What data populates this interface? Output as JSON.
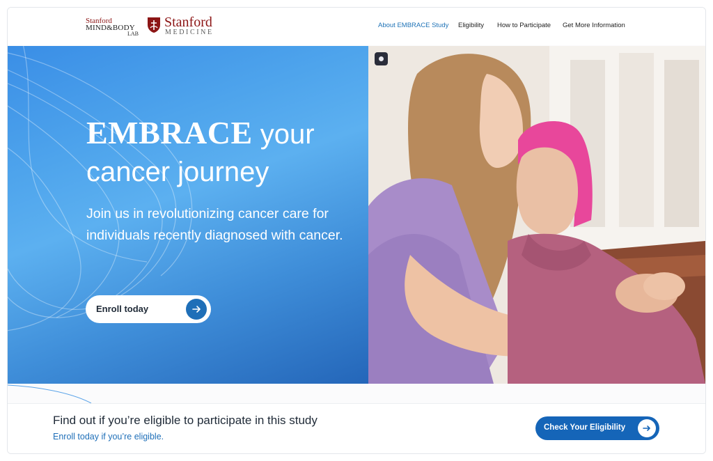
{
  "header": {
    "logo_mindbody": {
      "line1": "Stanford",
      "line2": "MIND&BODY",
      "line3": "LAB"
    },
    "logo_medicine": {
      "name": "Stanford",
      "sub": "MEDICINE"
    },
    "nav": [
      {
        "label": "About EMBRACE Study",
        "active": true
      },
      {
        "label": "Eligibility",
        "active": false
      },
      {
        "label": "How to Participate",
        "active": false
      },
      {
        "label": "Get More Information",
        "active": false
      }
    ]
  },
  "hero": {
    "title_emphasis": "EMBRACE",
    "title_rest_line1": " your",
    "title_line2": "cancer journey",
    "subtitle": "Join us in revolutionizing cancer care for individuals recently diagnosed with cancer.",
    "enroll_label": "Enroll today",
    "pause_icon": "pause-icon"
  },
  "eligibility_cta": {
    "title": "Find out if you’re eligible to participate in this study",
    "link": "Enroll today if you’re eligible.",
    "button_label": "Check Your Eligibility"
  },
  "colors": {
    "brand_red": "#8c1515",
    "nav_active": "#1f73b7",
    "hero_blue": "#3a8ee6",
    "button_blue": "#1565b8"
  }
}
